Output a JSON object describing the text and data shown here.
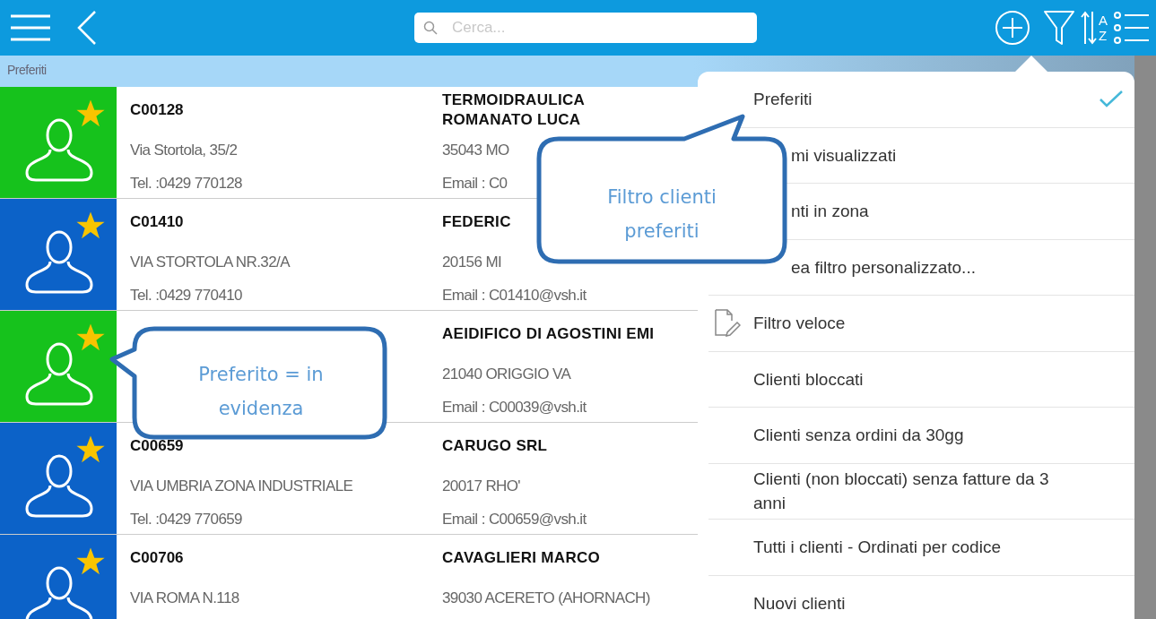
{
  "toolbar": {
    "search": {
      "placeholder": "Cerca..."
    },
    "sort_letters": [
      "A",
      "Z"
    ]
  },
  "section_header": "Preferiti",
  "clients": [
    {
      "color": "#16c21c",
      "favorite": true,
      "code": "C00128",
      "address": "Via Stortola, 35/2",
      "phone": "Tel. :0429 770128",
      "name": "TERMOIDRAULICA\nROMANATO LUCA",
      "city": "35043 MO",
      "email": "Email : C0"
    },
    {
      "color": "#0c62c8",
      "favorite": true,
      "code": "C01410",
      "address": "VIA STORTOLA NR.32/A",
      "phone": "Tel. :0429 770410",
      "name": "FEDERIC",
      "city": "20156 MI",
      "email": "Email : C01410@vsh.it"
    },
    {
      "color": "#16c21c",
      "favorite": true,
      "name": "AEIDIFICO DI AGOSTINI EMI",
      "city": "21040 ORIGGIO VA",
      "email": "Email : C00039@vsh.it"
    },
    {
      "color": "#0c62c8",
      "favorite": true,
      "code": "C00659",
      "address": "VIA UMBRIA ZONA INDUSTRIALE",
      "phone": "Tel. :0429 770659",
      "name": "CARUGO SRL",
      "city": "20017 RHO'",
      "email": "Email : C00659@vsh.it"
    },
    {
      "color": "#0c62c8",
      "favorite": true,
      "code": "C00706",
      "address": "VIA ROMA N.118",
      "name": "CAVAGLIERI MARCO",
      "city": "39030 ACERETO (AHORNACH)"
    }
  ],
  "filter_menu": [
    {
      "label": "Preferiti",
      "selected": true,
      "covered": false,
      "kind": "plain"
    },
    {
      "label": "mi visualizzati",
      "selected": false,
      "covered": true,
      "kind": "plain"
    },
    {
      "label": "nti in zona",
      "selected": false,
      "covered": true,
      "kind": "plain"
    },
    {
      "label": "ea filtro personalizzato...",
      "selected": false,
      "covered": true,
      "kind": "plain"
    },
    {
      "label": "Filtro veloce",
      "selected": false,
      "covered": false,
      "kind": "quick"
    },
    {
      "label": "Clienti bloccati",
      "selected": false,
      "covered": false,
      "kind": "plain"
    },
    {
      "label": "Clienti senza ordini da 30gg",
      "selected": false,
      "covered": false,
      "kind": "plain"
    },
    {
      "label": "Clienti (non bloccati) senza fatture da 3 anni",
      "selected": false,
      "covered": false,
      "kind": "plain"
    },
    {
      "label": "Tutti i clienti - Ordinati per codice",
      "selected": false,
      "covered": false,
      "kind": "plain"
    },
    {
      "label": "Nuovi clienti",
      "selected": false,
      "covered": false,
      "kind": "plain"
    }
  ],
  "callouts": [
    {
      "kind": "menu",
      "text": "Filtro clienti preferiti"
    },
    {
      "kind": "avatar",
      "text": "Preferito = in evidenza"
    }
  ]
}
